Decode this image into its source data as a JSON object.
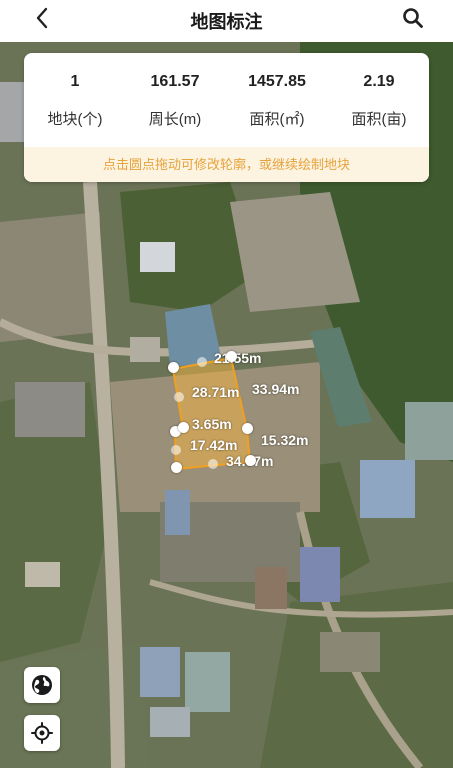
{
  "header": {
    "title": "地图标注"
  },
  "stats": [
    {
      "value": "1",
      "label": "地块(个)"
    },
    {
      "value": "161.57",
      "label": "周长(m)"
    },
    {
      "value": "1457.85",
      "label": "面积(㎡)"
    },
    {
      "value": "2.19",
      "label": "面积(亩)"
    }
  ],
  "hint": "点击圆点拖动可修改轮廓，或继续绘制地块",
  "polygon": {
    "edge_labels": [
      "28.71m",
      "21.55m",
      "33.94m",
      "3.65m",
      "17.42m",
      "15.32m",
      "34.07m"
    ],
    "fill_color": "#f5b642",
    "stroke_color": "#f0a020"
  },
  "controls": {
    "globe": "globe-icon",
    "locate": "locate-icon"
  }
}
